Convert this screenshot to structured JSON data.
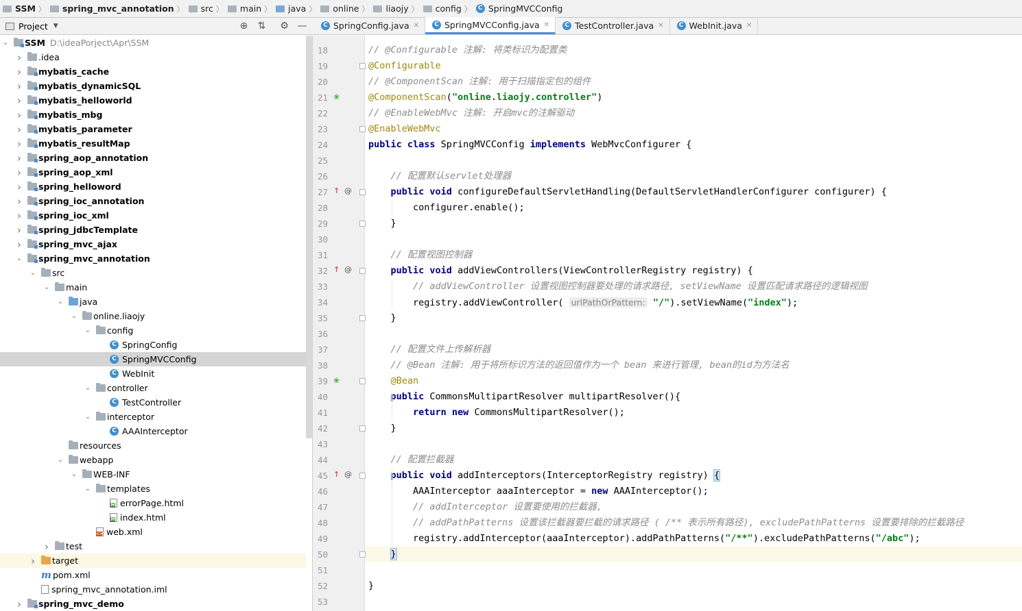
{
  "breadcrumb": [
    {
      "label": "SSM",
      "icon": "module-folder-icon",
      "bold": true
    },
    {
      "label": "spring_mvc_annotation",
      "icon": "module-folder-icon",
      "bold": true
    },
    {
      "label": "src",
      "icon": "folder-icon"
    },
    {
      "label": "main",
      "icon": "folder-icon"
    },
    {
      "label": "java",
      "icon": "source-folder-icon"
    },
    {
      "label": "online",
      "icon": "package-icon"
    },
    {
      "label": "liaojy",
      "icon": "package-icon"
    },
    {
      "label": "config",
      "icon": "package-icon"
    },
    {
      "label": "SpringMVCConfig",
      "icon": "class-icon"
    }
  ],
  "project_panel": {
    "title": "Project",
    "tools": [
      "locate-icon",
      "collapse-icon",
      "gear-icon",
      "minimize-icon"
    ]
  },
  "tree": [
    {
      "depth": 0,
      "arrow": "down",
      "icon": "module",
      "label": "SSM",
      "bold": true,
      "path": "D:\\ideaPorject\\Apr\\SSM"
    },
    {
      "depth": 1,
      "arrow": "right",
      "icon": "folder",
      "label": ".idea"
    },
    {
      "depth": 1,
      "arrow": "right",
      "icon": "module",
      "label": "mybatis_cache",
      "bold": true
    },
    {
      "depth": 1,
      "arrow": "right",
      "icon": "module",
      "label": "mybatis_dynamicSQL",
      "bold": true
    },
    {
      "depth": 1,
      "arrow": "right",
      "icon": "module",
      "label": "mybatis_helloworld",
      "bold": true
    },
    {
      "depth": 1,
      "arrow": "right",
      "icon": "module",
      "label": "mybatis_mbg",
      "bold": true
    },
    {
      "depth": 1,
      "arrow": "right",
      "icon": "module",
      "label": "mybatis_parameter",
      "bold": true
    },
    {
      "depth": 1,
      "arrow": "right",
      "icon": "module",
      "label": "mybatis_resultMap",
      "bold": true
    },
    {
      "depth": 1,
      "arrow": "right",
      "icon": "module",
      "label": "spring_aop_annotation",
      "bold": true
    },
    {
      "depth": 1,
      "arrow": "right",
      "icon": "module",
      "label": "spring_aop_xml",
      "bold": true
    },
    {
      "depth": 1,
      "arrow": "right",
      "icon": "module",
      "label": "spring_helloword",
      "bold": true
    },
    {
      "depth": 1,
      "arrow": "right",
      "icon": "module",
      "label": "spring_ioc_annotation",
      "bold": true
    },
    {
      "depth": 1,
      "arrow": "right",
      "icon": "module",
      "label": "spring_ioc_xml",
      "bold": true
    },
    {
      "depth": 1,
      "arrow": "right",
      "icon": "module",
      "label": "spring_jdbcTemplate",
      "bold": true
    },
    {
      "depth": 1,
      "arrow": "right",
      "icon": "module",
      "label": "spring_mvc_ajax",
      "bold": true
    },
    {
      "depth": 1,
      "arrow": "down",
      "icon": "module",
      "label": "spring_mvc_annotation",
      "bold": true
    },
    {
      "depth": 2,
      "arrow": "down",
      "icon": "folder",
      "label": "src"
    },
    {
      "depth": 3,
      "arrow": "down",
      "icon": "folder",
      "label": "main"
    },
    {
      "depth": 4,
      "arrow": "down",
      "icon": "folder-blue",
      "label": "java"
    },
    {
      "depth": 5,
      "arrow": "down",
      "icon": "folder",
      "label": "online.liaojy"
    },
    {
      "depth": 6,
      "arrow": "down",
      "icon": "folder",
      "label": "config"
    },
    {
      "depth": 7,
      "arrow": "",
      "icon": "class",
      "label": "SpringConfig"
    },
    {
      "depth": 7,
      "arrow": "",
      "icon": "class",
      "label": "SpringMVCConfig",
      "selected": true
    },
    {
      "depth": 7,
      "arrow": "",
      "icon": "class",
      "label": "WebInit"
    },
    {
      "depth": 6,
      "arrow": "down",
      "icon": "folder",
      "label": "controller"
    },
    {
      "depth": 7,
      "arrow": "",
      "icon": "class",
      "label": "TestController"
    },
    {
      "depth": 6,
      "arrow": "down",
      "icon": "folder",
      "label": "interceptor"
    },
    {
      "depth": 7,
      "arrow": "",
      "icon": "class",
      "label": "AAAInterceptor"
    },
    {
      "depth": 4,
      "arrow": "",
      "icon": "folder",
      "label": "resources"
    },
    {
      "depth": 4,
      "arrow": "down",
      "icon": "folder",
      "label": "webapp"
    },
    {
      "depth": 5,
      "arrow": "down",
      "icon": "folder",
      "label": "WEB-INF"
    },
    {
      "depth": 6,
      "arrow": "down",
      "icon": "folder",
      "label": "templates"
    },
    {
      "depth": 7,
      "arrow": "",
      "icon": "html",
      "label": "errorPage.html"
    },
    {
      "depth": 7,
      "arrow": "",
      "icon": "html",
      "label": "index.html"
    },
    {
      "depth": 6,
      "arrow": "",
      "icon": "xml",
      "label": "web.xml"
    },
    {
      "depth": 3,
      "arrow": "right",
      "icon": "folder",
      "label": "test"
    },
    {
      "depth": 2,
      "arrow": "right",
      "icon": "folder-orange",
      "label": "target",
      "highlight": true
    },
    {
      "depth": 2,
      "arrow": "",
      "icon": "maven",
      "label": "pom.xml"
    },
    {
      "depth": 2,
      "arrow": "",
      "icon": "iml",
      "label": "spring_mvc_annotation.iml"
    },
    {
      "depth": 1,
      "arrow": "right",
      "icon": "module",
      "label": "spring_mvc_demo",
      "bold": true
    }
  ],
  "tabs": [
    {
      "label": "SpringConfig.java",
      "active": false
    },
    {
      "label": "SpringMVCConfig.java",
      "active": true
    },
    {
      "label": "TestController.java",
      "active": false
    },
    {
      "label": "WebInit.java",
      "active": false
    }
  ],
  "current_line": 50,
  "lines": [
    {
      "n": "18",
      "tokens": [
        [
          "c",
          "// @Configurable 注解: 将类标识为配置类"
        ]
      ]
    },
    {
      "n": "19",
      "tokens": [
        [
          "a",
          "@Configurable"
        ]
      ],
      "fold": true
    },
    {
      "n": "20",
      "tokens": [
        [
          "c",
          "// @ComponentScan 注解: 用于扫描指定包的组件"
        ]
      ]
    },
    {
      "n": "21",
      "tokens": [
        [
          "a",
          "@ComponentScan"
        ],
        [
          "t",
          "("
        ],
        [
          "s",
          "\"online.liaojy.controller\""
        ],
        [
          "t",
          ")"
        ]
      ],
      "gutter": "bean-icon"
    },
    {
      "n": "22",
      "tokens": [
        [
          "c",
          "// @EnableWebMvc 注解: 开启mvc的注解驱动"
        ]
      ]
    },
    {
      "n": "23",
      "tokens": [
        [
          "a",
          "@EnableWebMvc"
        ]
      ],
      "fold": true
    },
    {
      "n": "24",
      "tokens": [
        [
          "k",
          "public class "
        ],
        [
          "t",
          "SpringMVCConfig "
        ],
        [
          "k",
          "implements "
        ],
        [
          "t",
          "WebMvcConfigurer {"
        ]
      ]
    },
    {
      "n": "25",
      "tokens": []
    },
    {
      "n": "26",
      "tokens": [
        [
          "t",
          "    "
        ],
        [
          "c",
          "// 配置默认servlet处理器"
        ]
      ]
    },
    {
      "n": "27",
      "tokens": [
        [
          "t",
          "    "
        ],
        [
          "k",
          "public void "
        ],
        [
          "t",
          "configureDefaultServletHandling(DefaultServletHandlerConfigurer configurer) {"
        ]
      ],
      "gutter": "override-icon",
      "fold": true
    },
    {
      "n": "28",
      "tokens": [
        [
          "t",
          "        configurer.enable();"
        ]
      ]
    },
    {
      "n": "29",
      "tokens": [
        [
          "t",
          "    }"
        ]
      ],
      "fold": true
    },
    {
      "n": "30",
      "tokens": []
    },
    {
      "n": "31",
      "tokens": [
        [
          "t",
          "    "
        ],
        [
          "c",
          "// 配置视图控制器"
        ]
      ]
    },
    {
      "n": "32",
      "tokens": [
        [
          "t",
          "    "
        ],
        [
          "k",
          "public void "
        ],
        [
          "t",
          "addViewControllers(ViewControllerRegistry registry) {"
        ]
      ],
      "gutter": "override-icon",
      "fold": true
    },
    {
      "n": "33",
      "tokens": [
        [
          "t",
          "        "
        ],
        [
          "c",
          "// addViewController 设置视图控制器要处理的请求路径, setViewName 设置匹配请求路径的逻辑视图"
        ]
      ]
    },
    {
      "n": "34",
      "tokens": [
        [
          "t",
          "        registry.addViewController( "
        ],
        [
          "h",
          "urlPathOrPattern:"
        ],
        [
          "t",
          " "
        ],
        [
          "s",
          "\"/\""
        ],
        [
          "t",
          ").setViewName("
        ],
        [
          "s",
          "\"index\""
        ],
        [
          "t",
          ");"
        ]
      ]
    },
    {
      "n": "35",
      "tokens": [
        [
          "t",
          "    }"
        ]
      ],
      "fold": true
    },
    {
      "n": "36",
      "tokens": []
    },
    {
      "n": "37",
      "tokens": [
        [
          "t",
          "    "
        ],
        [
          "c",
          "// 配置文件上传解析器"
        ]
      ]
    },
    {
      "n": "38",
      "tokens": [
        [
          "t",
          "    "
        ],
        [
          "c",
          "// @Bean 注解: 用于将所标识方法的返回值作为一个 bean 来进行管理, bean的id为方法名"
        ]
      ]
    },
    {
      "n": "39",
      "tokens": [
        [
          "t",
          "    "
        ],
        [
          "a",
          "@Bean"
        ]
      ],
      "gutter": "bean-icon",
      "fold": true
    },
    {
      "n": "40",
      "tokens": [
        [
          "t",
          "    "
        ],
        [
          "k",
          "public "
        ],
        [
          "t",
          "CommonsMultipartResolver multipartResolver(){"
        ]
      ]
    },
    {
      "n": "41",
      "tokens": [
        [
          "t",
          "        "
        ],
        [
          "k",
          "return new "
        ],
        [
          "t",
          "CommonsMultipartResolver();"
        ]
      ]
    },
    {
      "n": "42",
      "tokens": [
        [
          "t",
          "    }"
        ]
      ],
      "fold": true
    },
    {
      "n": "43",
      "tokens": []
    },
    {
      "n": "44",
      "tokens": [
        [
          "t",
          "    "
        ],
        [
          "c",
          "// 配置拦截器"
        ]
      ]
    },
    {
      "n": "45",
      "tokens": [
        [
          "t",
          "    "
        ],
        [
          "k",
          "public void "
        ],
        [
          "t",
          "addInterceptors(InterceptorRegistry registry) "
        ],
        [
          "b",
          "{"
        ]
      ],
      "gutter": "override-icon",
      "fold": true
    },
    {
      "n": "46",
      "tokens": [
        [
          "t",
          "        AAAInterceptor aaaInterceptor = "
        ],
        [
          "k",
          "new "
        ],
        [
          "t",
          "AAAInterceptor();"
        ]
      ]
    },
    {
      "n": "47",
      "tokens": [
        [
          "t",
          "        "
        ],
        [
          "c",
          "// addInterceptor 设置要使用的拦截器,"
        ]
      ]
    },
    {
      "n": "48",
      "tokens": [
        [
          "t",
          "        "
        ],
        [
          "c",
          "// addPathPatterns 设置该拦截器要拦截的请求路径 ( /** 表示所有路径), excludePathPatterns 设置要排除的拦截路径"
        ]
      ]
    },
    {
      "n": "49",
      "tokens": [
        [
          "t",
          "        registry.addInterceptor(aaaInterceptor).addPathPatterns("
        ],
        [
          "s",
          "\"/**\""
        ],
        [
          "t",
          ").excludePathPatterns("
        ],
        [
          "s",
          "\"/abc\""
        ],
        [
          "t",
          ");"
        ]
      ]
    },
    {
      "n": "50",
      "tokens": [
        [
          "t",
          "    "
        ],
        [
          "b",
          "}"
        ]
      ],
      "fold": true
    },
    {
      "n": "51",
      "tokens": []
    },
    {
      "n": "52",
      "tokens": [
        [
          "t",
          "}"
        ]
      ]
    },
    {
      "n": "53",
      "tokens": []
    }
  ],
  "colors": {
    "comment": "#8c8c8c",
    "annotation": "#9e880d",
    "keyword": "#000080",
    "string": "#067d17",
    "selection": "#d5d5d5",
    "current_line": "#fcfae6",
    "tab_underline": "#4e8de0"
  }
}
